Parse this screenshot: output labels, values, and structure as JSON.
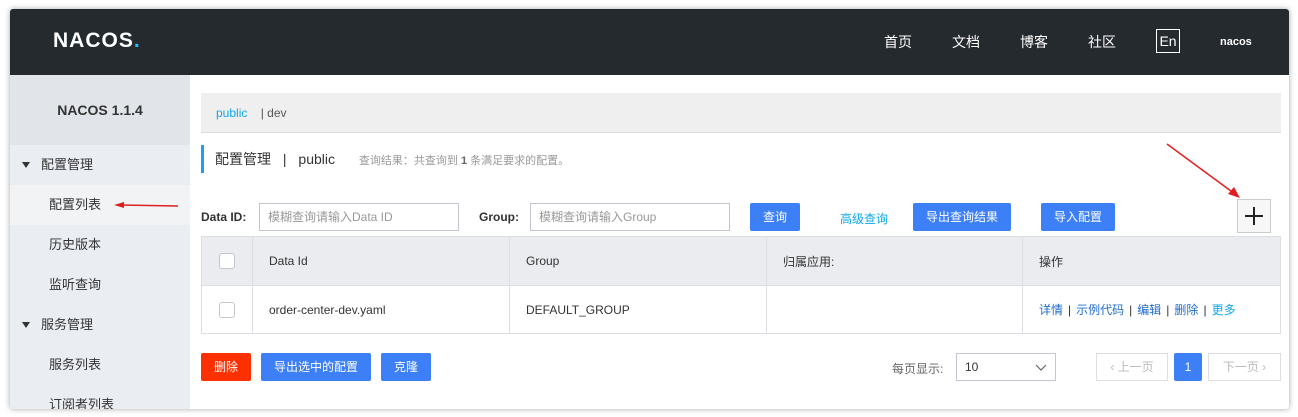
{
  "header": {
    "logo_text": "NACOS",
    "nav": [
      "首页",
      "文档",
      "博客",
      "社区"
    ],
    "lang_button": "En",
    "user": "nacos"
  },
  "sidebar": {
    "title": "NACOS 1.1.4",
    "groups": [
      {
        "label": "配置管理",
        "items": [
          "配置列表",
          "历史版本",
          "监听查询"
        ]
      },
      {
        "label": "服务管理",
        "items": [
          "服务列表",
          "订阅者列表"
        ]
      }
    ]
  },
  "namespace": {
    "active": "public",
    "other": "| dev"
  },
  "page": {
    "title": "配置管理",
    "separator": "|",
    "namespace": "public",
    "result_prefix": "查询结果：共查询到",
    "result_count": "1",
    "result_suffix": "条满足要求的配置。"
  },
  "search": {
    "data_id_label": "Data ID:",
    "data_id_placeholder": "模糊查询请输入Data ID",
    "group_label": "Group:",
    "group_placeholder": "模糊查询请输入Group",
    "query_button": "查询",
    "advanced_link": "高级查询",
    "export_button": "导出查询结果",
    "import_button": "导入配置",
    "add_button": "+"
  },
  "table": {
    "columns": [
      "Data Id",
      "Group",
      "归属应用:",
      "操作"
    ],
    "rows": [
      {
        "data_id": "order-center-dev.yaml",
        "group": "DEFAULT_GROUP",
        "app": ""
      }
    ],
    "actions": [
      "详情",
      "示例代码",
      "编辑",
      "删除",
      "更多"
    ],
    "action_separator": "|"
  },
  "footer": {
    "delete_button": "删除",
    "export_selected_button": "导出选中的配置",
    "clone_button": "克隆",
    "page_size_label": "每页显示:",
    "page_size": "10",
    "prev": "上一页",
    "current_page": "1",
    "next": "下一页"
  },
  "colors": {
    "header_bg": "#252a2f",
    "primary": "#3c7ff7",
    "danger": "#ff3000",
    "link": "#0fa8ec",
    "annotation_arrow": "#e02020"
  }
}
